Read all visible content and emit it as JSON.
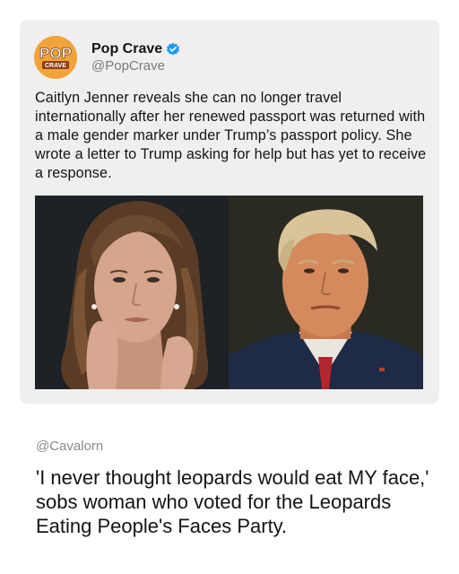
{
  "tweet": {
    "avatar": {
      "line1": "POP",
      "line2": "CRAVE",
      "bg": "#f2a33a"
    },
    "display_name": "Pop Crave",
    "verified_color": "#1d9bf0",
    "handle": "@PopCrave",
    "text": "Caitlyn Jenner reveals she can no longer travel internationally after her renewed passport was returned with a male gender marker under Trump’s passport policy. She wrote a letter to Trump asking for help but has yet to receive a response."
  },
  "reply": {
    "handle": "@Cavalorn",
    "text": "'I never thought leopards would eat MY face,' sobs woman who voted for the Leopards Eating People's Faces Party."
  }
}
